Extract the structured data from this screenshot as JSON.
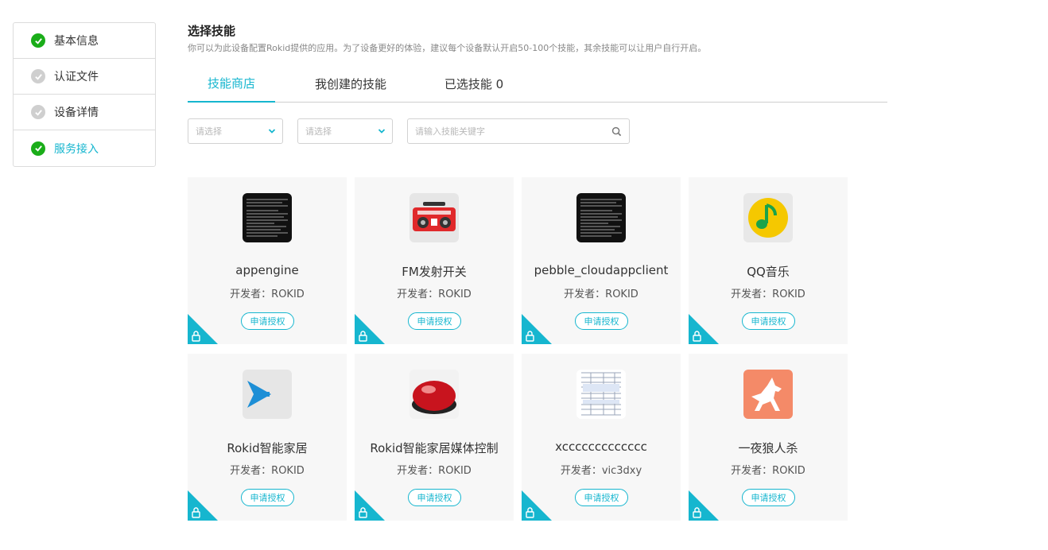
{
  "steps": [
    {
      "label": "基本信息",
      "state": "done"
    },
    {
      "label": "认证文件",
      "state": "pending"
    },
    {
      "label": "设备详情",
      "state": "pending"
    },
    {
      "label": "服务接入",
      "state": "active"
    }
  ],
  "header": {
    "title": "选择技能",
    "subtitle": "你可以为此设备配置Rokid提供的应用。为了设备更好的体验，建议每个设备默认开启50-100个技能，其余技能可以让用户自行开启。"
  },
  "tabs": [
    {
      "label": "技能商店"
    },
    {
      "label": "我创建的技能"
    },
    {
      "label": "已选技能 0"
    }
  ],
  "filters": {
    "select1_placeholder": "请选择",
    "select2_placeholder": "请选择",
    "search_placeholder": "请输入技能关键字"
  },
  "skills": [
    {
      "name": "appengine",
      "developer": "开发者：ROKID",
      "button": "申请授权",
      "icon": "terminal-icon"
    },
    {
      "name": "FM发射开关",
      "developer": "开发者：ROKID",
      "button": "申请授权",
      "icon": "radio-icon"
    },
    {
      "name": "pebble_cloudappclient",
      "developer": "开发者：ROKID",
      "button": "申请授权",
      "icon": "terminal-icon"
    },
    {
      "name": "QQ音乐",
      "developer": "开发者：ROKID",
      "button": "申请授权",
      "icon": "qq-music-icon"
    },
    {
      "name": "Rokid智能家居",
      "developer": "开发者：ROKID",
      "button": "申请授权",
      "icon": "arrow-icon"
    },
    {
      "name": "Rokid智能家居媒体控制",
      "developer": "开发者：ROKID",
      "button": "申请授权",
      "icon": "red-ball-icon"
    },
    {
      "name": "xccccccccccccc",
      "developer": "开发者：vic3dxy",
      "button": "申请授权",
      "icon": "document-icon"
    },
    {
      "name": "一夜狼人杀",
      "developer": "开发者：ROKID",
      "button": "申请授权",
      "icon": "wolf-icon"
    }
  ],
  "colors": {
    "accent": "#16b6cf",
    "success": "#1aad19",
    "card_bg": "#f7f7f7"
  }
}
